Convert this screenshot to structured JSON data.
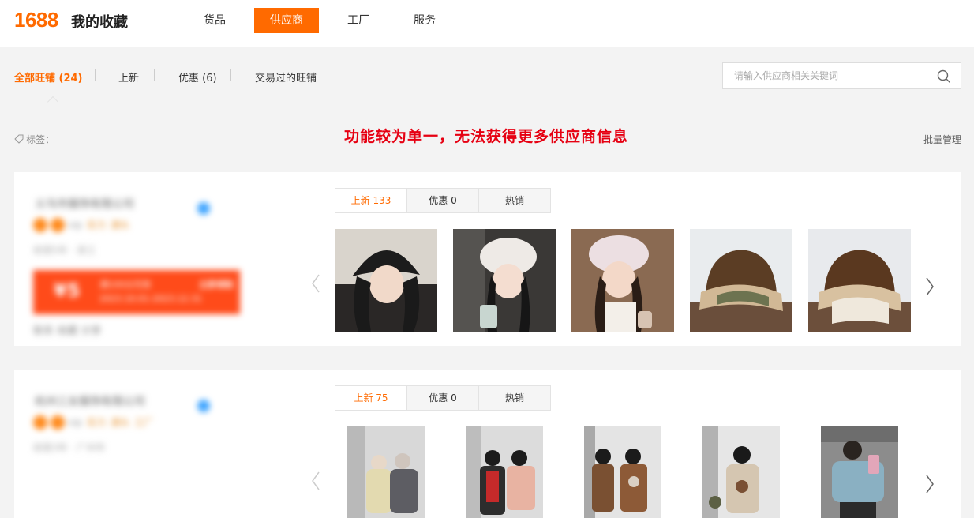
{
  "header": {
    "logo": "1688",
    "title": "我的收藏",
    "nav": [
      {
        "label": "货品",
        "active": false
      },
      {
        "label": "供应商",
        "active": true
      },
      {
        "label": "工厂",
        "active": false
      },
      {
        "label": "服务",
        "active": false
      }
    ]
  },
  "subtabs": [
    {
      "label": "全部旺铺 (24)",
      "active": true
    },
    {
      "label": "上新",
      "active": false
    },
    {
      "label": "优惠 (6)",
      "active": false
    },
    {
      "label": "交易过的旺铺",
      "active": false
    }
  ],
  "search": {
    "placeholder": "请输入供应商相关关键词",
    "value": ""
  },
  "tags": {
    "label": "标签："
  },
  "annotation": "功能较为单一，无法获得更多供应商信息",
  "batch_manage": "批量管理",
  "colors": {
    "accent": "#ff6a00",
    "annotation": "#e60012",
    "verify": "#3ea4ff",
    "coupon": "#ff4b1a"
  },
  "suppliers": [
    {
      "name": "义乌市服饰有限公司",
      "badge_text": "vip",
      "badge_labels": [
        "实力",
        "源头"
      ],
      "meta": "经营5年 · 浙江",
      "coupon": {
        "amount": "¥5",
        "line1": "满100元可用",
        "line2": "2023.10.01-2023.12.31",
        "get": "立即领取"
      },
      "actions": "联系 收藏 分享",
      "tabs": [
        {
          "label": "上新 133",
          "active": true
        },
        {
          "label": "优惠 0",
          "active": false
        },
        {
          "label": "热销",
          "active": false
        }
      ]
    },
    {
      "name": "杭州三女服饰有限公司",
      "badge_text": "vip",
      "badge_labels": [
        "实力",
        "源头",
        "工厂"
      ],
      "meta": "经营3年 · 广州市",
      "tabs": [
        {
          "label": "上新 75",
          "active": true
        },
        {
          "label": "优惠 0",
          "active": false
        },
        {
          "label": "热销",
          "active": false
        }
      ]
    }
  ]
}
